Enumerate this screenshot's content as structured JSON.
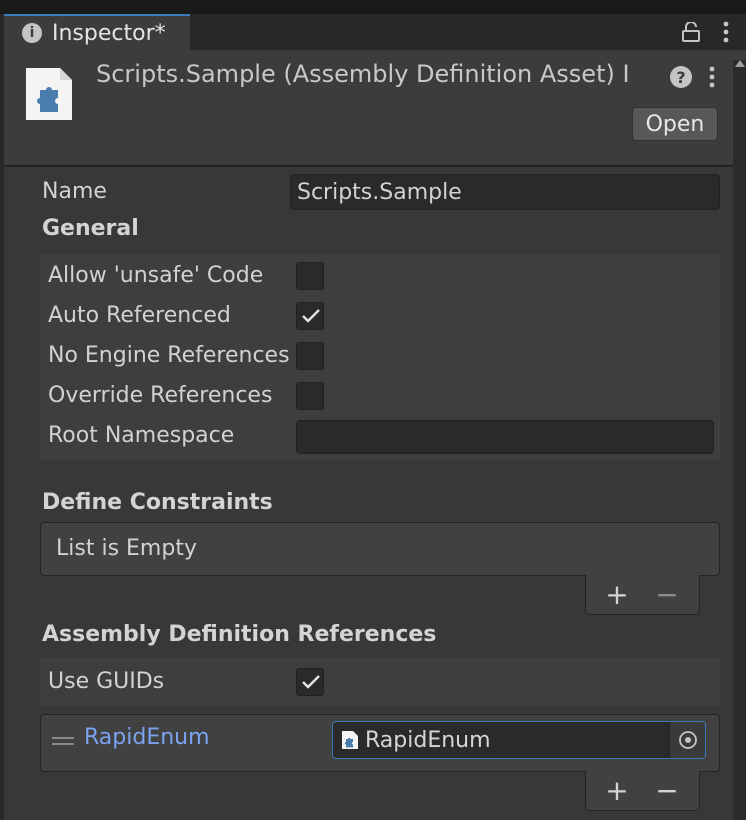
{
  "tab": {
    "title": "Inspector*"
  },
  "header": {
    "title": "Scripts.Sample (Assembly Definition Asset) I",
    "open_label": "Open"
  },
  "fields": {
    "name_label": "Name",
    "name_value": "Scripts.Sample"
  },
  "general": {
    "heading": "General",
    "rows": [
      {
        "label": "Allow 'unsafe' Code",
        "checked": false
      },
      {
        "label": "Auto Referenced",
        "checked": true
      },
      {
        "label": "No Engine References",
        "checked": false
      },
      {
        "label": "Override References",
        "checked": false
      }
    ],
    "root_namespace_label": "Root Namespace",
    "root_namespace_value": ""
  },
  "define_constraints": {
    "heading": "Define Constraints",
    "empty_text": "List is Empty"
  },
  "assembly_refs": {
    "heading": "Assembly Definition References",
    "use_guids_label": "Use GUIDs",
    "use_guids_checked": true,
    "items": [
      {
        "name": "RapidEnum",
        "value": "RapidEnum"
      }
    ]
  },
  "list_buttons": {
    "add": "+",
    "remove": "−"
  },
  "colors": {
    "accent": "#3a79bb",
    "link": "#7ba3f0",
    "panel": "#383838"
  }
}
